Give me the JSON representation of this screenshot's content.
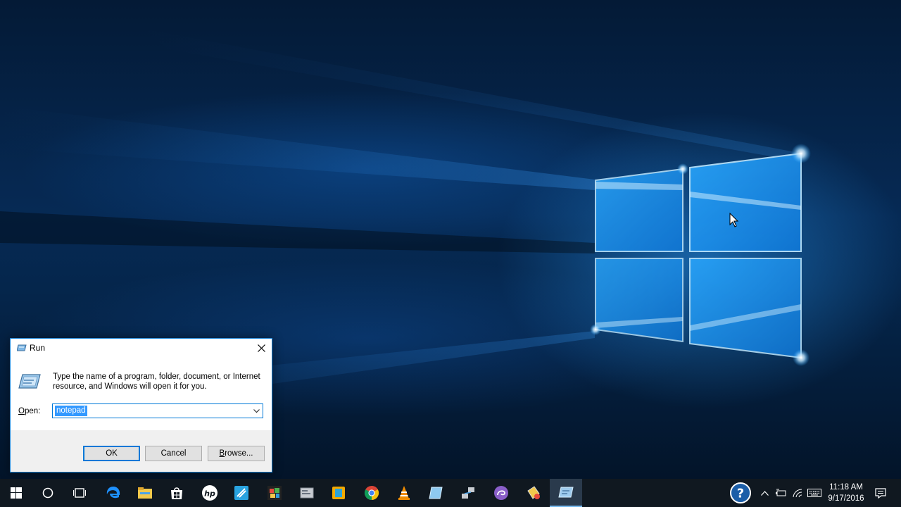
{
  "run_dialog": {
    "title": "Run",
    "description": "Type the name of a program, folder, document, or Internet resource, and Windows will open it for you.",
    "open_label_prefix": "O",
    "open_label_rest": "pen:",
    "open_value": "notepad",
    "ok_label": "OK",
    "cancel_label": "Cancel",
    "browse_label_prefix": "B",
    "browse_label_rest": "rowse..."
  },
  "taskbar": {
    "pinned_icons": [
      "windows-start-icon",
      "cortana-search-icon",
      "task-view-icon",
      "edge-icon",
      "file-explorer-icon",
      "store-icon",
      "hp-icon",
      "app-icon",
      "photo-app-icon",
      "settings-app-icon",
      "app-icon",
      "chrome-icon",
      "vlc-icon",
      "app-icon",
      "network-app-icon",
      "torrent-icon",
      "app-icon",
      "run-icon"
    ],
    "clock_time": "11:18 AM",
    "clock_date": "9/17/2016"
  },
  "colors": {
    "accent": "#0078d7",
    "selection": "#3399ff",
    "taskbar": "#101820"
  }
}
